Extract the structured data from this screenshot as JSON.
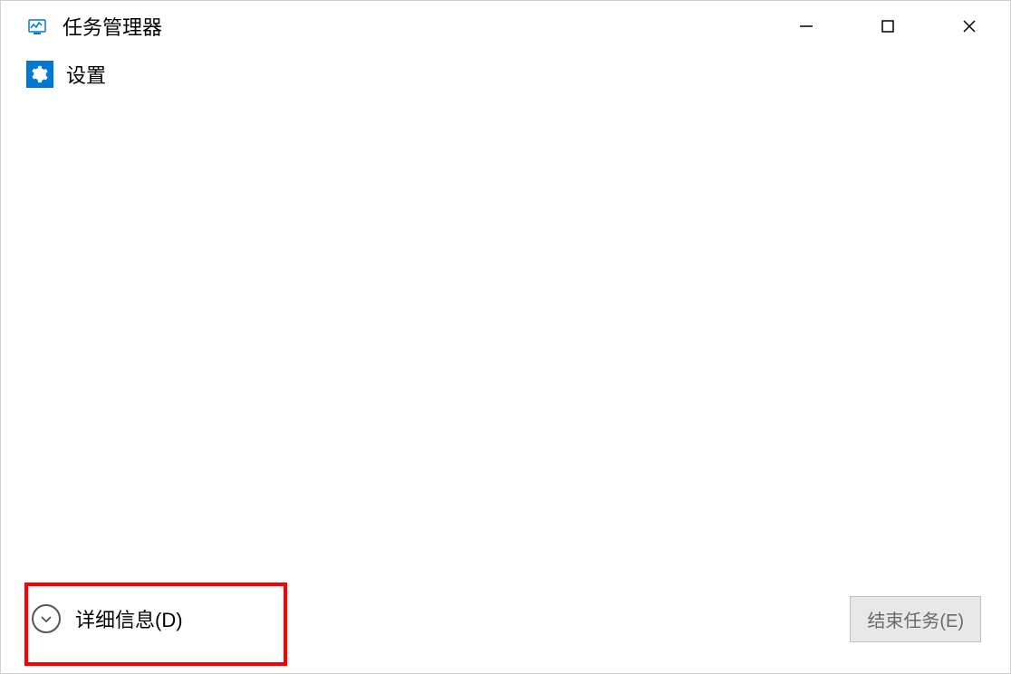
{
  "titlebar": {
    "title": "任务管理器"
  },
  "menubar": {
    "settings_label": "设置"
  },
  "footer": {
    "details_label": "详细信息(D)",
    "end_task_label": "结束任务(E)"
  }
}
